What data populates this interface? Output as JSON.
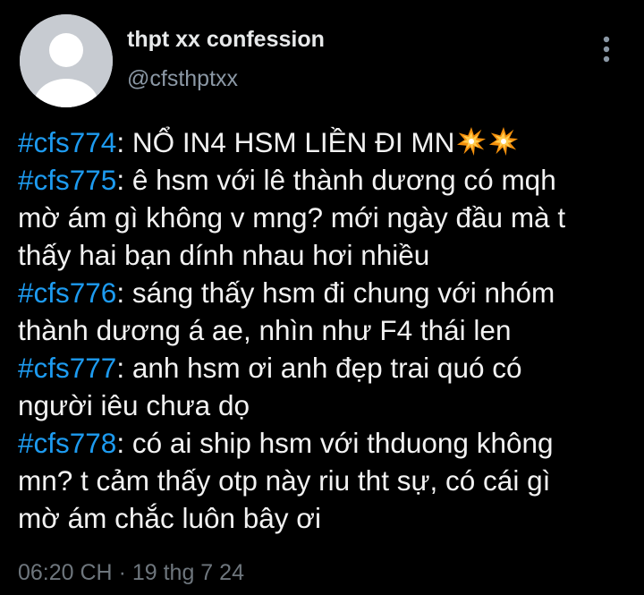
{
  "author": {
    "display_name": "thpt xx confession",
    "handle": "@cfsthptxx",
    "avatar_icon": "default-profile-icon"
  },
  "menu": {
    "icon": "more-vertical-icon"
  },
  "tweet": {
    "lines": [
      {
        "hashtag": "#cfs774",
        "text": ": NỔ IN4 HSM LIỀN ĐI MN",
        "emoji": [
          "collision-icon",
          "collision-icon"
        ]
      },
      {
        "hashtag": "#cfs775",
        "text": ": ê hsm với lê thành dương có mqh"
      },
      {
        "text": "mờ ám gì không v mng? mới ngày đầu mà t"
      },
      {
        "text": "thấy hai bạn dính nhau hơi nhiều"
      },
      {
        "hashtag": "#cfs776",
        "text": ": sáng thấy hsm đi chung với nhóm"
      },
      {
        "text": "thành dương á ae, nhìn như F4 thái len"
      },
      {
        "hashtag": "#cfs777",
        "text": ": anh hsm ơi anh đẹp trai quó có"
      },
      {
        "text": "người iêu chưa dọ"
      },
      {
        "hashtag": "#cfs778",
        "text": ": có ai ship hsm với thduong không"
      },
      {
        "text": "mn? t cảm thấy otp này riu tht sự, có cái gì"
      },
      {
        "text": "mờ ám chắc luôn bây ơi"
      }
    ]
  },
  "meta": {
    "time": "06:20 CH",
    "separator": "·",
    "date": "19 thg 7 24"
  },
  "colors": {
    "background": "#000000",
    "text": "#e7e9ea",
    "hashtag": "#1d9bf0",
    "secondary": "#8b98a5",
    "timestamp": "#6e767d",
    "avatar_bg": "#c7cbd1",
    "avatar_fg": "#ffffff"
  }
}
